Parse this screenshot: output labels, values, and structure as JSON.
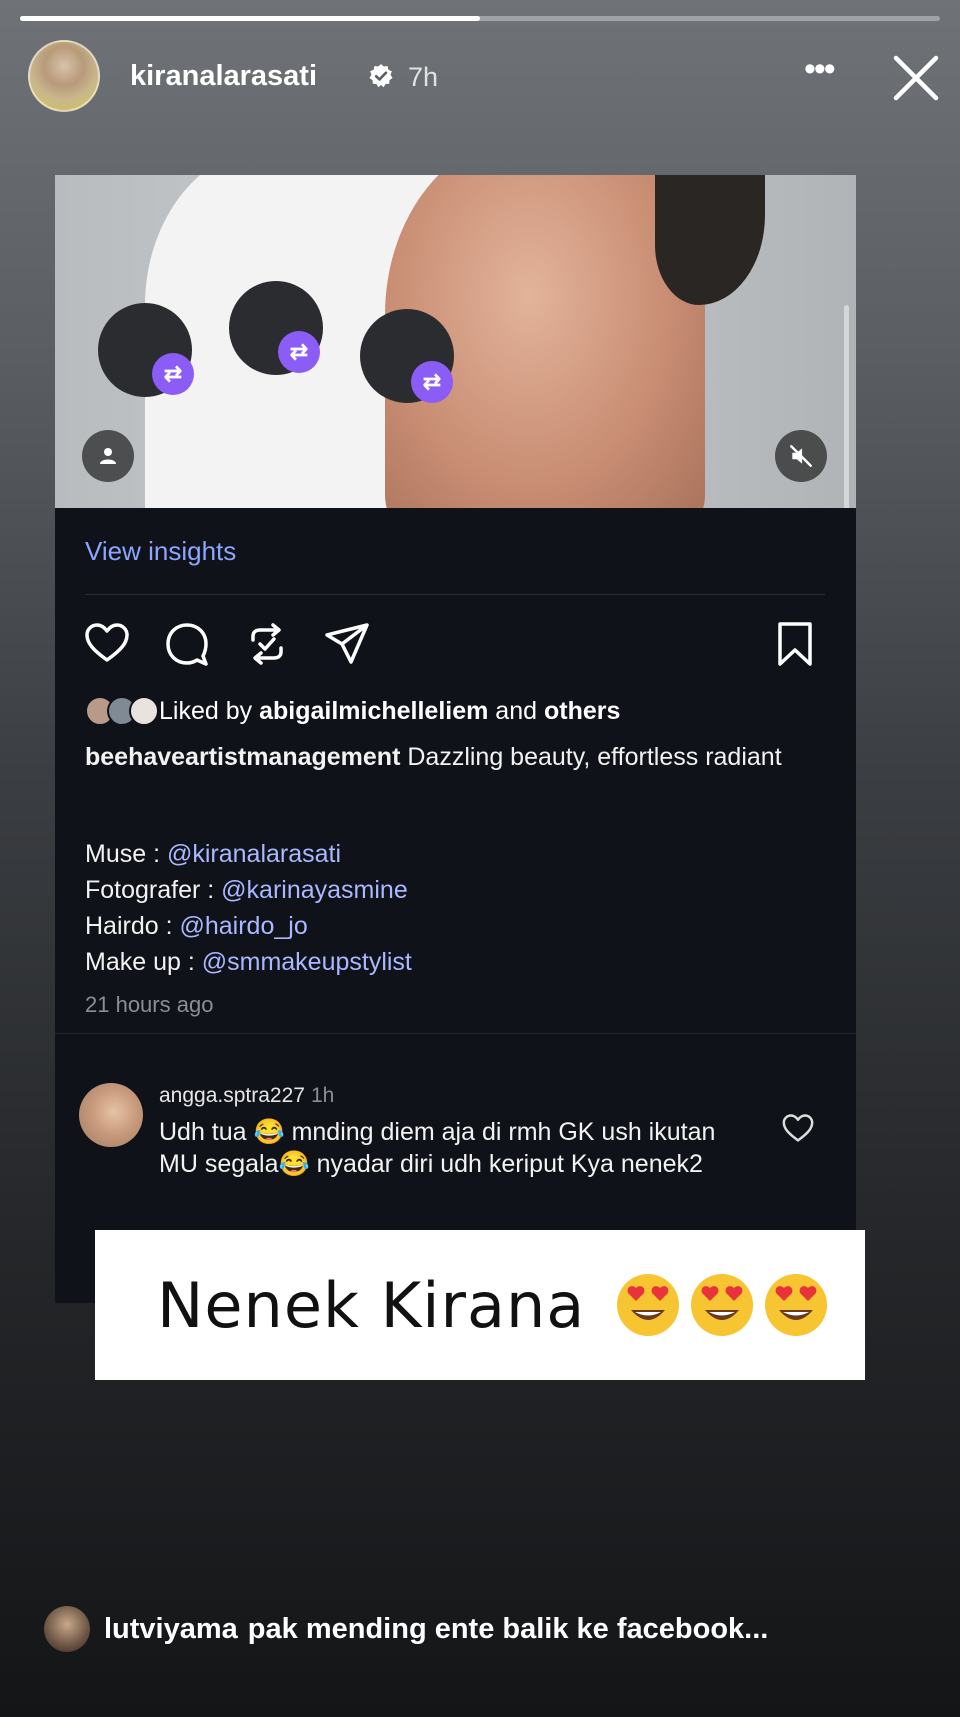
{
  "story": {
    "progress": 0.5,
    "username": "kiranalarasati",
    "time": "7h",
    "more_icon": "more-horizontal-icon",
    "close_icon": "close-icon"
  },
  "post": {
    "view_insights": "View insights",
    "liked_by_prefix": "Liked by",
    "liked_by_user": "abigailmichelleliem",
    "liked_by_and": "and",
    "liked_by_others": "others",
    "caption_user": "beehaveartistmanagement",
    "caption_text": "Dazzling beauty, effortless radiant",
    "credits": [
      {
        "label": "Muse : ",
        "mention": "@kiranalarasati"
      },
      {
        "label": "Fotografer : ",
        "mention": "@karinayasmine"
      },
      {
        "label": "Hairdo : ",
        "mention": "@hairdo_jo"
      },
      {
        "label": "Make up : ",
        "mention": "@smmakeupstylist"
      }
    ],
    "time": "21 hours ago"
  },
  "comment": {
    "user": "angga.sptra227",
    "time": "1h",
    "text": "Udh tua 😂 mnding diem aja di rmh GK ush ikutan MU segala😂 nyadar diri udh keriput Kya nenek2"
  },
  "sticker": {
    "text": "Nenek Kirana",
    "emoji": "heart-eyes-emoji"
  },
  "reply": {
    "user": "lutviyama",
    "text": "pak mending ente balik ke facebook..."
  },
  "colors": {
    "accent": "#8b5cf6",
    "link": "#a9b8ff",
    "insights": "#8ea5ff"
  }
}
